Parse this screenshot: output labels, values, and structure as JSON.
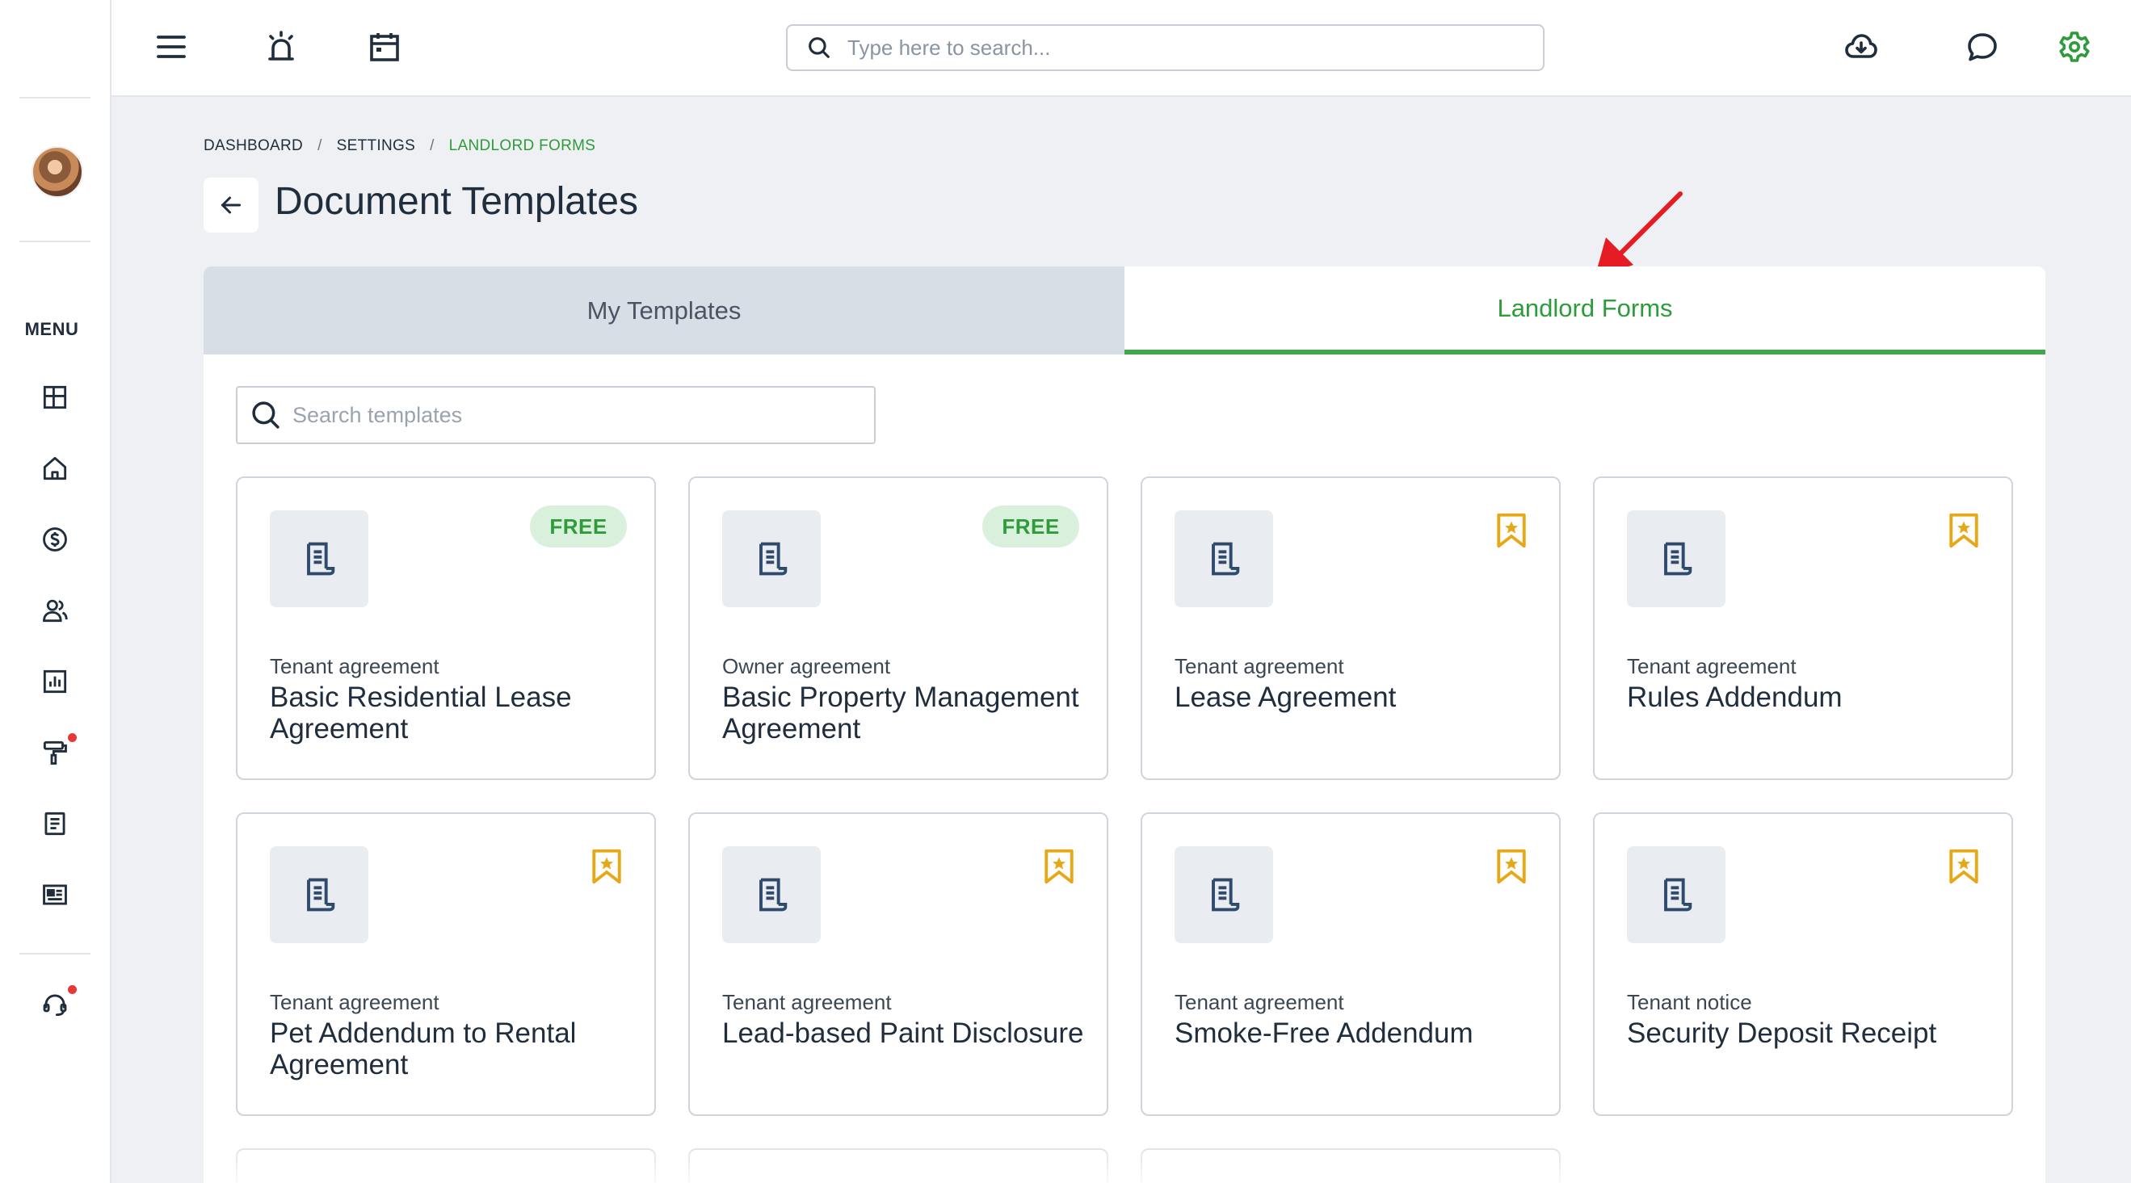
{
  "topbar": {
    "search_placeholder": "Type here to search..."
  },
  "sidebar": {
    "menu_label": "MENU",
    "items": [
      {
        "icon": "dashboard-grid-icon"
      },
      {
        "icon": "home-icon"
      },
      {
        "icon": "dollar-icon"
      },
      {
        "icon": "people-icon"
      },
      {
        "icon": "report-chart-icon"
      },
      {
        "icon": "paint-roller-icon",
        "notification": true
      },
      {
        "icon": "document-icon"
      },
      {
        "icon": "listing-card-icon"
      }
    ],
    "support": {
      "icon": "headset-icon",
      "notification": true
    }
  },
  "breadcrumb": {
    "items": [
      "DASHBOARD",
      "SETTINGS",
      "LANDLORD FORMS"
    ]
  },
  "page": {
    "title": "Document Templates"
  },
  "tabs": [
    {
      "label": "My Templates",
      "active": false
    },
    {
      "label": "Landlord Forms",
      "active": true
    }
  ],
  "template_search": {
    "placeholder": "Search templates"
  },
  "templates": [
    {
      "category": "Tenant agreement",
      "title": "Basic Residential Lease Agreement",
      "badge": "FREE"
    },
    {
      "category": "Owner agreement",
      "title": "Basic Property Management Agreement",
      "badge": "FREE"
    },
    {
      "category": "Tenant agreement",
      "title": "Lease Agreement",
      "badge": "premium"
    },
    {
      "category": "Tenant agreement",
      "title": "Rules Addendum",
      "badge": "premium"
    },
    {
      "category": "Tenant agreement",
      "title": "Pet Addendum to Rental Agreement",
      "badge": "premium"
    },
    {
      "category": "Tenant agreement",
      "title": "Lead-based Paint Disclosure",
      "badge": "premium"
    },
    {
      "category": "Tenant agreement",
      "title": "Smoke-Free Addendum",
      "badge": "premium"
    },
    {
      "category": "Tenant notice",
      "title": "Security Deposit Receipt",
      "badge": "premium"
    }
  ],
  "colors": {
    "accent_green": "#2e9c3a",
    "premium_gold": "#e6a817",
    "notification_red": "#e53935"
  }
}
